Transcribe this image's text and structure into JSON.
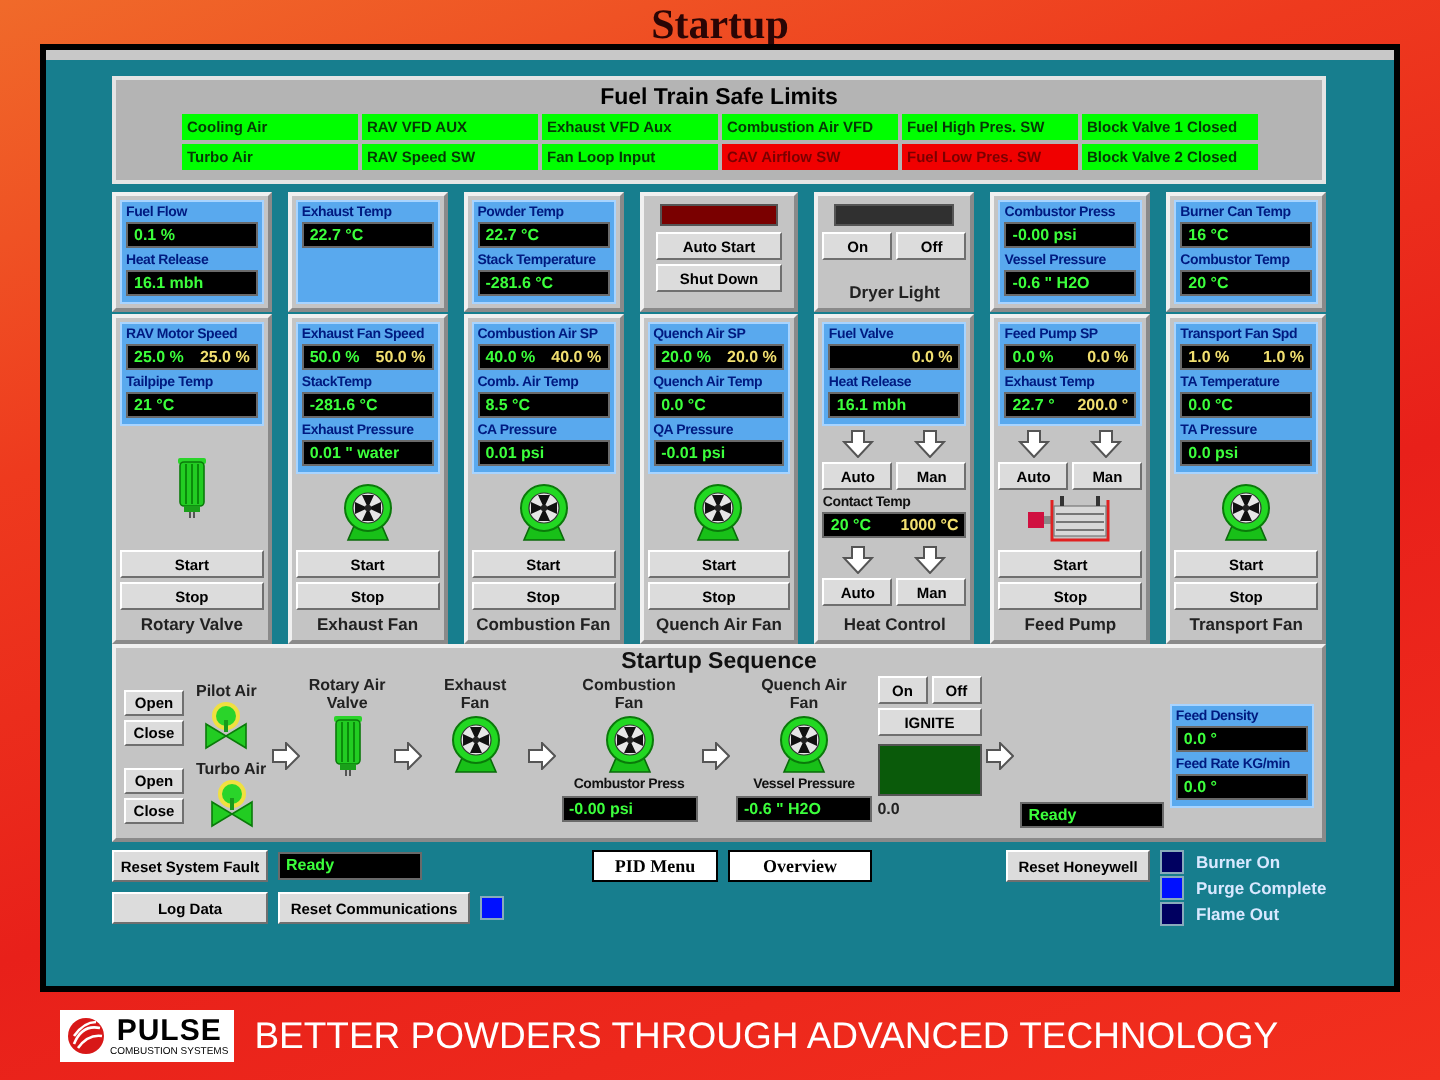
{
  "slide": {
    "title": "Startup",
    "slogan": "BETTER POWDERS THROUGH ADVANCED TECHNOLOGY",
    "logo": {
      "name": "PULSE",
      "tagline": "COMBUSTION SYSTEMS"
    }
  },
  "safe_limits": {
    "title": "Fuel Train Safe Limits",
    "rows": [
      [
        {
          "label": "Cooling Air",
          "alarm": false
        },
        {
          "label": "RAV VFD AUX",
          "alarm": false
        },
        {
          "label": "Exhaust VFD Aux",
          "alarm": false
        },
        {
          "label": "Combustion Air VFD",
          "alarm": false
        },
        {
          "label": "Fuel High Pres. SW",
          "alarm": false
        },
        {
          "label": "Block Valve 1 Closed",
          "alarm": false
        }
      ],
      [
        {
          "label": "Turbo Air",
          "alarm": false
        },
        {
          "label": "RAV Speed SW",
          "alarm": false
        },
        {
          "label": "Fan Loop Input",
          "alarm": false
        },
        {
          "label": "CAV Airflow SW",
          "alarm": true
        },
        {
          "label": "Fuel Low Pres. SW",
          "alarm": true
        },
        {
          "label": "Block Valve 2 Closed",
          "alarm": false
        }
      ]
    ]
  },
  "top_panels": [
    {
      "blocks": [
        {
          "kind": "readouts",
          "items": [
            {
              "label": "Fuel Flow",
              "values": [
                {
                  "text": "0.1 %",
                  "kind": "actual"
                }
              ]
            },
            {
              "label": "Heat Release",
              "values": [
                {
                  "text": "16.1 mbh",
                  "kind": "actual"
                }
              ]
            }
          ]
        }
      ]
    },
    {
      "blocks": [
        {
          "kind": "readouts",
          "items": [
            {
              "label": "Exhaust Temp",
              "values": [
                {
                  "text": "22.7 °C",
                  "kind": "actual"
                }
              ]
            }
          ]
        }
      ]
    },
    {
      "blocks": [
        {
          "kind": "readouts",
          "items": [
            {
              "label": "Powder Temp",
              "values": [
                {
                  "text": "22.7 °C",
                  "kind": "actual"
                }
              ]
            },
            {
              "label": "Stack Temperature",
              "values": [
                {
                  "text": "-281.6 °C",
                  "kind": "actual"
                }
              ]
            }
          ]
        }
      ]
    },
    {
      "blocks": [
        {
          "kind": "lamp",
          "color": "#7a0000"
        },
        {
          "kind": "button_stack",
          "labels": [
            "Auto Start",
            "Shut Down"
          ]
        }
      ]
    },
    {
      "blocks": [
        {
          "kind": "lamp",
          "color": "#303030"
        },
        {
          "kind": "button_row",
          "labels": [
            "On",
            "Off"
          ]
        }
      ],
      "label": "Dryer Light"
    },
    {
      "blocks": [
        {
          "kind": "readouts",
          "items": [
            {
              "label": "Combustor Press",
              "values": [
                {
                  "text": "-0.00 psi",
                  "kind": "actual"
                }
              ]
            },
            {
              "label": "Vessel Pressure",
              "values": [
                {
                  "text": "-0.6 \" H2O",
                  "kind": "actual"
                }
              ]
            }
          ]
        }
      ]
    },
    {
      "blocks": [
        {
          "kind": "readouts",
          "items": [
            {
              "label": "Burner Can Temp",
              "values": [
                {
                  "text": "16 °C",
                  "kind": "actual"
                }
              ]
            },
            {
              "label": "Combustor Temp",
              "values": [
                {
                  "text": "20 °C",
                  "kind": "actual"
                }
              ]
            }
          ]
        }
      ]
    }
  ],
  "unit_panels": [
    {
      "blocks": [
        {
          "kind": "readouts",
          "items": [
            {
              "label": "RAV Motor Speed",
              "values": [
                {
                  "text": "25.0 %",
                  "kind": "actual"
                },
                {
                  "text": "25.0 %",
                  "kind": "setpoint"
                }
              ]
            },
            {
              "label": "Tailpipe Temp",
              "values": [
                {
                  "text": "21 °C",
                  "kind": "actual"
                }
              ]
            }
          ]
        },
        {
          "kind": "motor"
        },
        {
          "kind": "button_stack",
          "labels": [
            "Start",
            "Stop"
          ]
        }
      ],
      "label": "Rotary Valve"
    },
    {
      "blocks": [
        {
          "kind": "readouts",
          "items": [
            {
              "label": "Exhaust Fan Speed",
              "values": [
                {
                  "text": "50.0 %",
                  "kind": "actual"
                },
                {
                  "text": "50.0 %",
                  "kind": "setpoint"
                }
              ]
            },
            {
              "label": "StackTemp",
              "values": [
                {
                  "text": "-281.6 °C",
                  "kind": "actual"
                }
              ]
            },
            {
              "label": "Exhaust Pressure",
              "values": [
                {
                  "text": "0.01 \" water",
                  "kind": "actual"
                }
              ]
            }
          ]
        },
        {
          "kind": "fan"
        },
        {
          "kind": "button_stack",
          "labels": [
            "Start",
            "Stop"
          ]
        }
      ],
      "label": "Exhaust Fan"
    },
    {
      "blocks": [
        {
          "kind": "readouts",
          "items": [
            {
              "label": "Combustion Air SP",
              "values": [
                {
                  "text": "40.0 %",
                  "kind": "actual"
                },
                {
                  "text": "40.0 %",
                  "kind": "setpoint"
                }
              ]
            },
            {
              "label": "Comb. Air Temp",
              "values": [
                {
                  "text": "8.5 °C",
                  "kind": "actual"
                }
              ]
            },
            {
              "label": "CA Pressure",
              "values": [
                {
                  "text": "0.01 psi",
                  "kind": "actual"
                }
              ]
            }
          ]
        },
        {
          "kind": "fan"
        },
        {
          "kind": "button_stack",
          "labels": [
            "Start",
            "Stop"
          ]
        }
      ],
      "label": "Combustion Fan"
    },
    {
      "blocks": [
        {
          "kind": "readouts",
          "items": [
            {
              "label": "Quench Air SP",
              "values": [
                {
                  "text": "20.0 %",
                  "kind": "actual"
                },
                {
                  "text": "20.0 %",
                  "kind": "setpoint"
                }
              ]
            },
            {
              "label": "Quench Air Temp",
              "values": [
                {
                  "text": "0.0 °C",
                  "kind": "actual"
                }
              ]
            },
            {
              "label": "QA Pressure",
              "values": [
                {
                  "text": "-0.01 psi",
                  "kind": "actual"
                }
              ]
            }
          ]
        },
        {
          "kind": "fan"
        },
        {
          "kind": "button_stack",
          "labels": [
            "Start",
            "Stop"
          ]
        }
      ],
      "label": "Quench Air Fan"
    },
    {
      "blocks": [
        {
          "kind": "readouts",
          "items": [
            {
              "label": "Fuel Valve",
              "values": [
                {
                  "text": "0.0 %",
                  "kind": "setpoint"
                }
              ]
            },
            {
              "label": "Heat Release",
              "values": [
                {
                  "text": "16.1 mbh",
                  "kind": "actual"
                }
              ]
            }
          ]
        },
        {
          "kind": "arrows"
        },
        {
          "kind": "button_row",
          "labels": [
            "Auto",
            "Man"
          ]
        },
        {
          "kind": "plain_readout",
          "label": "Contact Temp",
          "values": [
            {
              "text": "20 °C",
              "kind": "actual"
            },
            {
              "text": "1000 °C",
              "kind": "setpoint"
            }
          ]
        },
        {
          "kind": "arrows"
        },
        {
          "kind": "button_row",
          "labels": [
            "Auto",
            "Man"
          ]
        }
      ],
      "label": "Heat Control"
    },
    {
      "blocks": [
        {
          "kind": "readouts",
          "items": [
            {
              "label": "Feed Pump SP",
              "values": [
                {
                  "text": "0.0 %",
                  "kind": "actual"
                },
                {
                  "text": "0.0 %",
                  "kind": "setpoint"
                }
              ]
            },
            {
              "label": "Exhaust Temp",
              "values": [
                {
                  "text": "22.7 °",
                  "kind": "actual"
                },
                {
                  "text": "200.0 °",
                  "kind": "setpoint"
                }
              ]
            }
          ]
        },
        {
          "kind": "arrows"
        },
        {
          "kind": "button_row",
          "labels": [
            "Auto",
            "Man"
          ]
        },
        {
          "kind": "pump"
        },
        {
          "kind": "button_stack",
          "labels": [
            "Start",
            "Stop"
          ]
        }
      ],
      "label": "Feed Pump"
    },
    {
      "blocks": [
        {
          "kind": "readouts",
          "items": [
            {
              "label": "Transport Fan Spd",
              "values": [
                {
                  "text": "1.0 %",
                  "kind": "setpoint"
                },
                {
                  "text": "1.0 %",
                  "kind": "setpoint"
                }
              ]
            },
            {
              "label": "TA Temperature",
              "values": [
                {
                  "text": "0.0 °C",
                  "kind": "actual"
                }
              ]
            },
            {
              "label": "TA Pressure",
              "values": [
                {
                  "text": "0.0 psi",
                  "kind": "actual"
                }
              ]
            }
          ]
        },
        {
          "kind": "fan"
        },
        {
          "kind": "button_stack",
          "labels": [
            "Start",
            "Stop"
          ]
        }
      ],
      "label": "Transport Fan"
    }
  ],
  "sequence": {
    "title": "Startup Sequence",
    "steps": [
      {
        "kind": "valves",
        "items": [
          {
            "label": "Pilot Air",
            "buttons": [
              "Open",
              "Close"
            ]
          },
          {
            "label": "Turbo Air",
            "buttons": [
              "Open",
              "Close"
            ]
          }
        ]
      },
      {
        "kind": "arrow"
      },
      {
        "kind": "motor",
        "label": "Rotary Air Valve"
      },
      {
        "kind": "arrow"
      },
      {
        "kind": "fan",
        "label": "Exhaust Fan"
      },
      {
        "kind": "arrow"
      },
      {
        "kind": "fan",
        "label": "Combustion Fan",
        "readout": {
          "label": "Combustor Press",
          "value": "-0.00 psi"
        }
      },
      {
        "kind": "arrow"
      },
      {
        "kind": "fan",
        "label": "Quench Air Fan",
        "readout": {
          "label": "Vessel Pressure",
          "value": "-0.6 \" H2O"
        }
      },
      {
        "kind": "igniter",
        "buttons": [
          "On",
          "Off"
        ],
        "action": "IGNITE",
        "lit": false,
        "reading": "0.0"
      },
      {
        "kind": "arrow"
      },
      {
        "kind": "status",
        "value": "Ready"
      },
      {
        "kind": "feed",
        "items": [
          {
            "label": "Feed Density",
            "value": "0.0 °"
          },
          {
            "label": "Feed Rate KG/min",
            "value": "0.0 °"
          }
        ]
      }
    ]
  },
  "controls": {
    "fault_reset": "Reset System Fault",
    "status": "Ready",
    "log": "Log Data",
    "comm_reset": "Reset Communications",
    "comm_lamp": {
      "on": true
    },
    "menus": [
      "PID Menu",
      "Overview"
    ],
    "honeywell_reset": "Reset Honeywell",
    "lamps": [
      {
        "label": "Burner On",
        "on": false
      },
      {
        "label": "Purge Complete",
        "on": true
      },
      {
        "label": "Flame Out",
        "on": false
      }
    ]
  }
}
